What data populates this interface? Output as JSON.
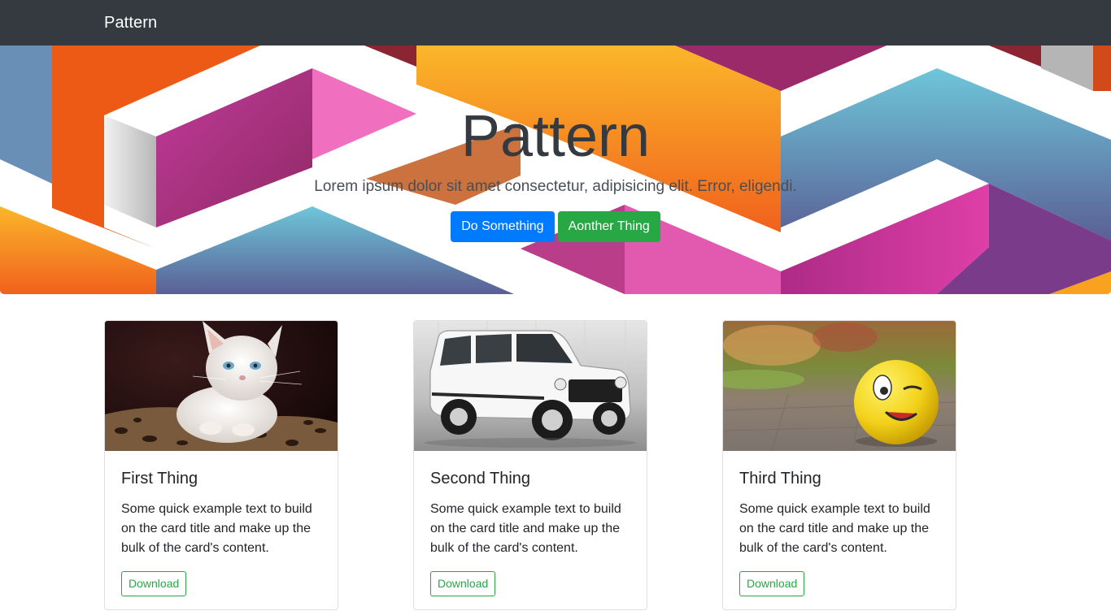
{
  "navbar": {
    "brand": "Pattern"
  },
  "hero": {
    "title": "Pattern",
    "lead": "Lorem ipsum dolor sit amet consectetur, adipisicing elit. Error, eligendi.",
    "primary_button": "Do Something",
    "secondary_button": "Aonther Thing"
  },
  "cards": [
    {
      "title": "First Thing",
      "text": "Some quick example text to build on the card title and make up the bulk of the card's content.",
      "button": "Download",
      "image": "kitten-photo"
    },
    {
      "title": "Second Thing",
      "text": "Some quick example text to build on the card title and make up the bulk of the card's content.",
      "button": "Download",
      "image": "white-suv-photo"
    },
    {
      "title": "Third Thing",
      "text": "Some quick example text to build on the card title and make up the bulk of the card's content.",
      "button": "Download",
      "image": "smiley-ball-photo"
    }
  ],
  "colors": {
    "navbar": "#343a40",
    "primary": "#007bff",
    "success": "#28a745"
  }
}
